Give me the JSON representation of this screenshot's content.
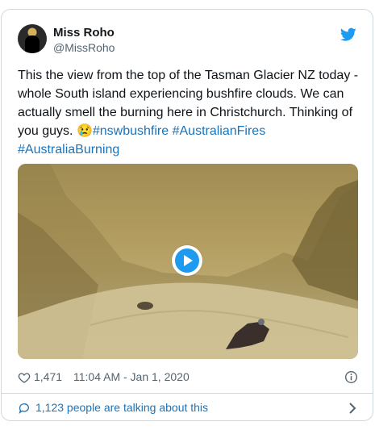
{
  "author": {
    "name": "Miss Roho",
    "handle": "@MissRoho"
  },
  "tweet": {
    "text": "This the view from the top of the Tasman Glacier NZ today - whole South island experiencing bushfire clouds. We can actually smell the burning here in Christchurch. Thinking of you guys. ",
    "emoji": "😢",
    "hashtags": [
      "#nswbushfire",
      "#AustralianFires",
      "#AustraliaBurning"
    ]
  },
  "meta": {
    "likes": "1,471",
    "timestamp": "11:04 AM - Jan 1, 2020"
  },
  "footer": {
    "talking": "1,123 people are talking about this"
  },
  "colors": {
    "link": "#1b73b8",
    "twitter_blue": "#1d9bf0",
    "muted": "#536471"
  },
  "icons": [
    "twitter-bird-icon",
    "play-icon",
    "heart-icon",
    "info-icon",
    "comment-bubble-icon",
    "chevron-right-icon"
  ]
}
